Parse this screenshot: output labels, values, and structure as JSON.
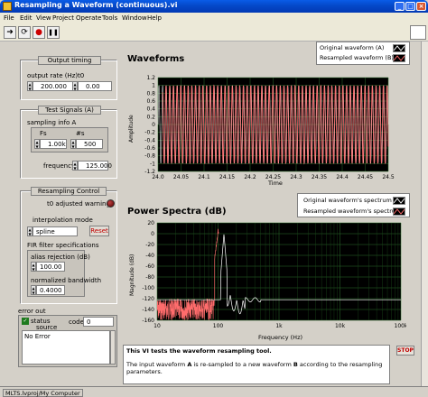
{
  "window": {
    "title": "Resampling a Waveform (continuous).vi"
  },
  "menu": [
    "File",
    "Edit",
    "View",
    "Project",
    "Operate",
    "Tools",
    "Window",
    "Help"
  ],
  "output_timing": {
    "title": "Output timing",
    "rate_label": "output rate (Hz)",
    "rate_value": "200.000",
    "t0_label": "t0",
    "t0_value": "0.00"
  },
  "test_signals": {
    "title": "Test Signals (A)",
    "sampling_label": "sampling info A",
    "fs_label": "Fs",
    "fs_value": "1.00k",
    "ns_label": "#s",
    "ns_value": "500",
    "frequency_label": "frequency",
    "frequency_value": "125.000"
  },
  "resampling": {
    "title": "Resampling Control",
    "t0_warning_label": "t0 adjusted warning",
    "interp_label": "interpolation mode",
    "interp_value": "spline",
    "reset_label": "Reset",
    "fir_label": "FIR filter specifications",
    "alias_label": "alias rejection (dB)",
    "alias_value": "100.00",
    "bw_label": "normalized bandwidth",
    "bw_value": "0.4000"
  },
  "error_out": {
    "title": "error out",
    "status_label": "status",
    "code_label": "code",
    "code_value": "0",
    "source_label": "source",
    "source_text": "No Error"
  },
  "waveforms": {
    "title": "Waveforms",
    "legend": [
      "Original waveform (A)",
      "Resampled waveform (B)"
    ],
    "ylabel": "Amplitude",
    "xlabel": "Time",
    "yticks": [
      "1.2",
      "1",
      "0.8",
      "0.6",
      "0.4",
      "0.2",
      "0",
      "-0.2",
      "-0.4",
      "-0.6",
      "-0.8",
      "-1",
      "-1.2"
    ],
    "xticks": [
      "24.0",
      "24.05",
      "24.1",
      "24.15",
      "24.2",
      "24.25",
      "24.3",
      "24.35",
      "24.4",
      "24.45",
      "24.5"
    ]
  },
  "spectra": {
    "title": "Power Spectra (dB)",
    "legend": [
      "Original waveform's spectrum",
      "Resampled waveform's spectrum"
    ],
    "ylabel": "Magnitude (dB)",
    "xlabel": "Frequency (Hz)",
    "yticks": [
      "20",
      "0",
      "-20",
      "-40",
      "-60",
      "-80",
      "-100",
      "-120",
      "-140",
      "-160"
    ],
    "xticks": [
      "10",
      "100",
      "1k",
      "10k",
      "100k"
    ]
  },
  "description": {
    "heading": "This VI tests the waveform resampling tool.",
    "body_pre": "The input waveform ",
    "a": "A",
    "body_mid": " is re-sampled to a new waveform ",
    "b": "B",
    "body_post": " according to the resampling parameters."
  },
  "stop_label": "STOP",
  "status_bar": "MLTS.lvproj/My Computer",
  "chart_data": [
    {
      "type": "line",
      "title": "Waveforms",
      "xlabel": "Time",
      "ylabel": "Amplitude",
      "xlim": [
        24.0,
        24.5
      ],
      "ylim": [
        -1.2,
        1.2
      ],
      "grid": true,
      "legend": "top-right",
      "series": [
        {
          "name": "Original waveform (A)",
          "color": "#ffffff",
          "frequency": 125,
          "amplitude": 1
        },
        {
          "name": "Resampled waveform (B)",
          "color": "#ff6c6c",
          "frequency": 125,
          "amplitude": 1
        }
      ]
    },
    {
      "type": "line",
      "title": "Power Spectra (dB)",
      "xlabel": "Frequency (Hz)",
      "ylabel": "Magnitude (dB)",
      "xscale": "log",
      "xlim": [
        10,
        100000
      ],
      "ylim": [
        -160,
        20
      ],
      "grid": true,
      "legend": "top-right",
      "series": [
        {
          "name": "Original waveform's spectrum",
          "color": "#ffffff",
          "peak_hz": 125,
          "peak_db": 0
        },
        {
          "name": "Resampled waveform's spectrum",
          "color": "#ff6c6c",
          "peak_hz": 100,
          "peak_db": 0
        }
      ]
    }
  ]
}
